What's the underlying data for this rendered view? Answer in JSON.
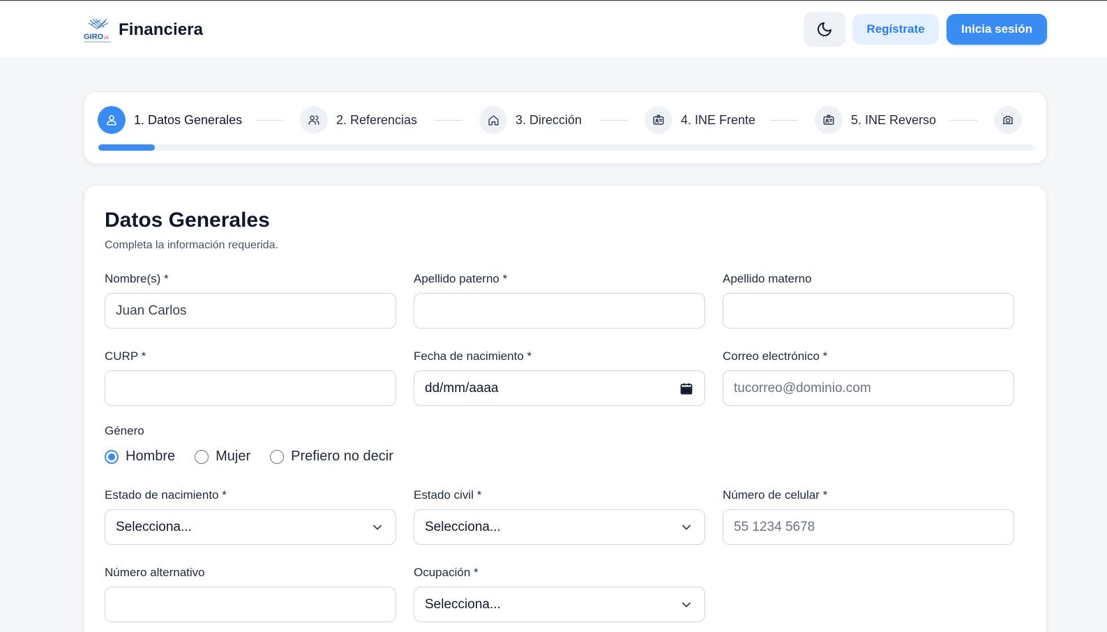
{
  "header": {
    "brand_name": "Financiera",
    "logo_text": "GIRO",
    "logo_subtext": "26",
    "register_label": "Regístrate",
    "login_label": "Inicia sesión"
  },
  "stepper": {
    "steps": [
      {
        "label": "1. Datos Generales",
        "icon": "user-icon",
        "active": true
      },
      {
        "label": "2. Referencias",
        "icon": "users-icon",
        "active": false
      },
      {
        "label": "3. Dirección",
        "icon": "home-icon",
        "active": false
      },
      {
        "label": "4. INE Frente",
        "icon": "id-card-icon",
        "active": false
      },
      {
        "label": "5. INE Reverso",
        "icon": "id-card-icon",
        "active": false
      },
      {
        "label": "",
        "icon": "camera-icon",
        "active": false
      }
    ],
    "progress_fraction": 0.06
  },
  "form": {
    "title": "Datos Generales",
    "subtitle": "Completa la información requerida.",
    "fields": {
      "nombre": {
        "label": "Nombre(s) *",
        "value": "Juan Carlos",
        "placeholder": ""
      },
      "apellido_paterno": {
        "label": "Apellido paterno *",
        "value": "",
        "placeholder": ""
      },
      "apellido_materno": {
        "label": "Apellido materno",
        "value": "",
        "placeholder": ""
      },
      "curp": {
        "label": "CURP *",
        "value": "",
        "placeholder": ""
      },
      "fecha_nacimiento": {
        "label": "Fecha de nacimiento *",
        "value": "dd/mm/aaaa"
      },
      "correo": {
        "label": "Correo electrónico *",
        "value": "",
        "placeholder": "tucorreo@dominio.com"
      },
      "estado_nacimiento": {
        "label": "Estado de nacimiento *",
        "selected": "Selecciona..."
      },
      "estado_civil": {
        "label": "Estado civil *",
        "selected": "Selecciona..."
      },
      "celular": {
        "label": "Número de celular *",
        "value": "",
        "placeholder": "55 1234 5678"
      },
      "alternativo": {
        "label": "Número alternativo",
        "value": "",
        "placeholder": ""
      },
      "ocupacion": {
        "label": "Ocupación *",
        "selected": "Selecciona..."
      }
    },
    "gender": {
      "label": "Género",
      "options": [
        "Hombre",
        "Mujer",
        "Prefiero no decir"
      ],
      "selected": "Hombre"
    }
  },
  "colors": {
    "accent": "#3b8cf2",
    "accent_light": "#e4efff",
    "background": "#f5f6f8",
    "card": "#ffffff"
  }
}
